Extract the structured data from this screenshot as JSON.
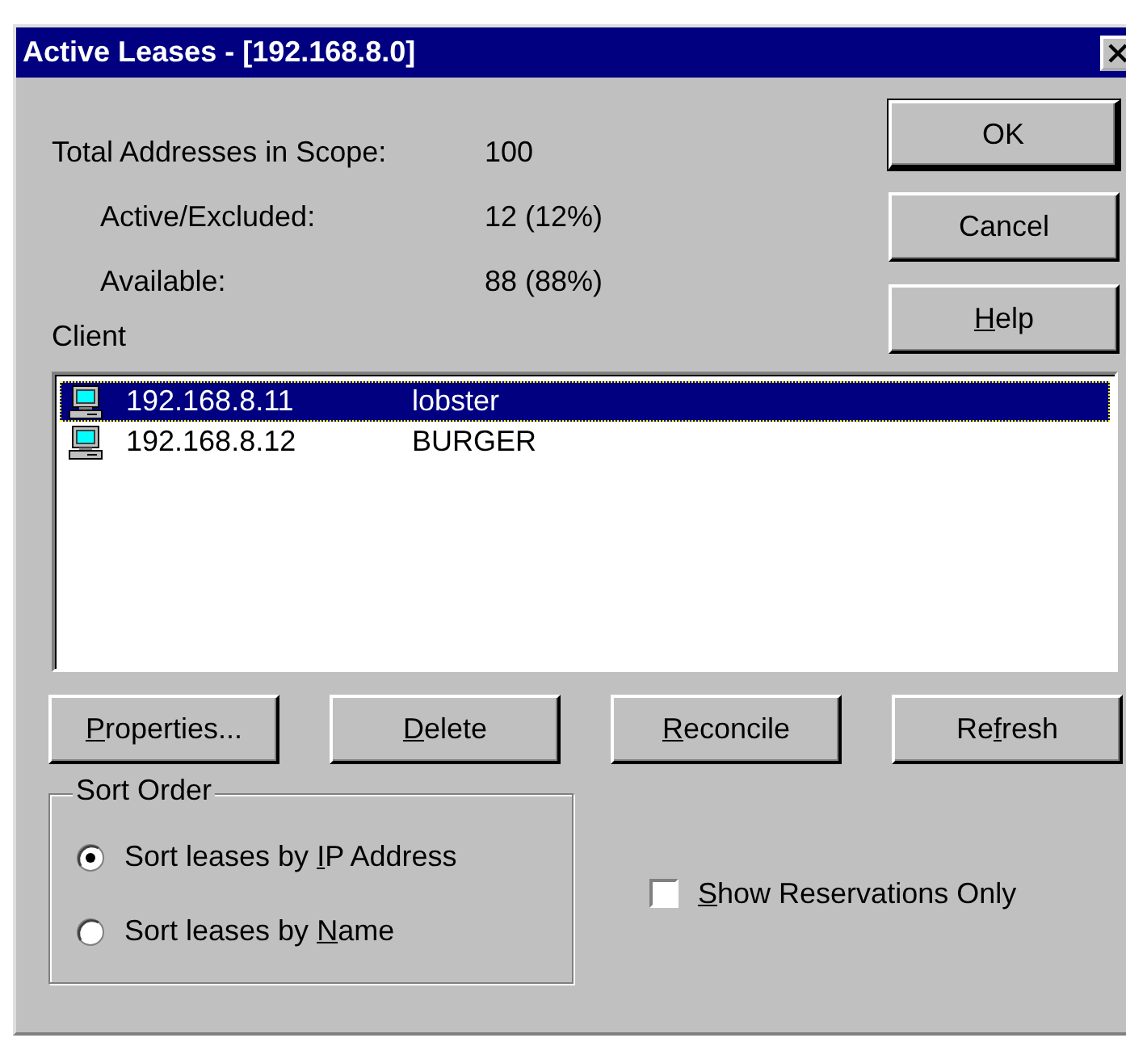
{
  "window": {
    "title": "Active Leases - [192.168.8.0]"
  },
  "scope": {
    "label": "Total Addresses in Scope:",
    "value": "100",
    "children": [
      {
        "label": "Active/Excluded:",
        "value": "12 (12%)"
      },
      {
        "label": "Available:",
        "value": "88 (88%)"
      }
    ]
  },
  "dialog_buttons": [
    {
      "before": "OK",
      "default": true
    },
    {
      "before": "Cancel",
      "default": false
    },
    {
      "key": "H",
      "after": "elp",
      "default": false
    }
  ],
  "client_list": {
    "label": "Client",
    "items": [
      {
        "ip": "192.168.8.11",
        "name": "lobster",
        "selected": true
      },
      {
        "ip": "192.168.8.12",
        "name": "BURGER",
        "selected": false
      }
    ]
  },
  "action_buttons": [
    {
      "key": "P",
      "after": "roperties..."
    },
    {
      "key": "D",
      "after": "elete"
    },
    {
      "key": "R",
      "after": "econcile"
    },
    {
      "before": "Re",
      "key": "f",
      "after": "resh"
    }
  ],
  "sort_order": {
    "title": "Sort Order",
    "options": [
      {
        "before": "Sort leases by ",
        "key": "I",
        "after": "P Address",
        "selected": true
      },
      {
        "before": "Sort leases by ",
        "key": "N",
        "after": "ame",
        "selected": false
      }
    ]
  },
  "show_reservations": {
    "key": "S",
    "after": "how Reservations Only",
    "checked": false
  }
}
